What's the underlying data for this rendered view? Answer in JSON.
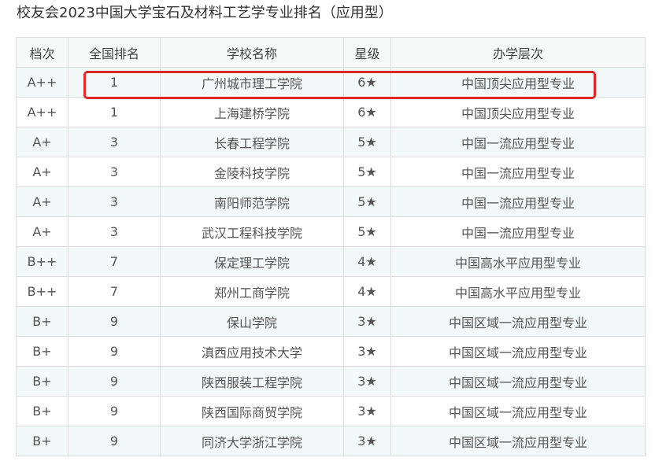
{
  "page": {
    "title": "校友会2023中国大学宝石及材料工艺学专业排名（应用型）"
  },
  "table": {
    "headers": [
      "档次",
      "全国排名",
      "学校名称",
      "星级",
      "办学层次"
    ],
    "rows": [
      [
        "A++",
        "1",
        "广州城市理工学院",
        "6★",
        "中国顶尖应用型专业"
      ],
      [
        "A++",
        "1",
        "上海建桥学院",
        "6★",
        "中国顶尖应用型专业"
      ],
      [
        "A+",
        "3",
        "长春工程学院",
        "5★",
        "中国一流应用型专业"
      ],
      [
        "A+",
        "3",
        "金陵科技学院",
        "5★",
        "中国一流应用型专业"
      ],
      [
        "A+",
        "3",
        "南阳师范学院",
        "5★",
        "中国一流应用型专业"
      ],
      [
        "A+",
        "3",
        "武汉工程科技学院",
        "5★",
        "中国一流应用型专业"
      ],
      [
        "B++",
        "7",
        "保定理工学院",
        "4★",
        "中国高水平应用型专业"
      ],
      [
        "B++",
        "7",
        "郑州工商学院",
        "4★",
        "中国高水平应用型专业"
      ],
      [
        "B+",
        "9",
        "保山学院",
        "3★",
        "中国区域一流应用型专业"
      ],
      [
        "B+",
        "9",
        "滇西应用技术大学",
        "3★",
        "中国区域一流应用型专业"
      ],
      [
        "B+",
        "9",
        "陕西服装工程学院",
        "3★",
        "中国区域一流应用型专业"
      ],
      [
        "B+",
        "9",
        "陕西国际商贸学院",
        "3★",
        "中国区域一流应用型专业"
      ],
      [
        "B+",
        "9",
        "同济大学浙江学院",
        "3★",
        "中国区域一流应用型专业"
      ]
    ]
  },
  "colors": {
    "highlight_border": "#e02828",
    "row_stripe": "#f3f8f8",
    "grid_line": "#dddddd"
  }
}
